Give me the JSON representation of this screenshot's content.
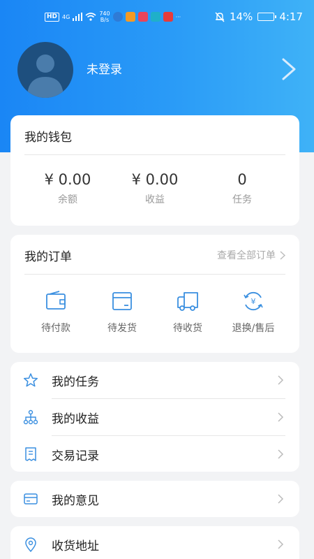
{
  "status_bar": {
    "network_tag": "HD",
    "signal": "4G",
    "speed_value": "740",
    "speed_unit": "B/s",
    "battery": "14%",
    "time": "4:17",
    "icons": [
      "wifi-icon",
      "mute-bell-icon",
      "battery-icon"
    ]
  },
  "profile": {
    "username": "未登录",
    "avatar_icon": "default-avatar-icon"
  },
  "wallet": {
    "title": "我的钱包",
    "stats": [
      {
        "value": "¥ 0.00",
        "label": "余额"
      },
      {
        "value": "¥ 0.00",
        "label": "收益"
      },
      {
        "value": "0",
        "label": "任务"
      }
    ]
  },
  "orders": {
    "title": "我的订单",
    "view_all": "查看全部订单",
    "items": [
      {
        "label": "待付款",
        "icon": "wallet-icon"
      },
      {
        "label": "待发货",
        "icon": "package-icon"
      },
      {
        "label": "待收货",
        "icon": "truck-icon"
      },
      {
        "label": "退换/售后",
        "icon": "refund-icon"
      }
    ]
  },
  "menu": {
    "group1": [
      {
        "label": "我的任务",
        "icon": "star-icon"
      },
      {
        "label": "我的收益",
        "icon": "hierarchy-icon"
      },
      {
        "label": "交易记录",
        "icon": "receipt-icon"
      }
    ],
    "group2": [
      {
        "label": "我的意见",
        "icon": "card-icon"
      }
    ],
    "group3": [
      {
        "label": "收货地址",
        "icon": "location-pin-icon"
      }
    ]
  },
  "colors": {
    "header_start": "#1a86f5",
    "header_end": "#3fb2f7",
    "icon_blue": "#3a8fe0",
    "background": "#f2f3f5"
  }
}
